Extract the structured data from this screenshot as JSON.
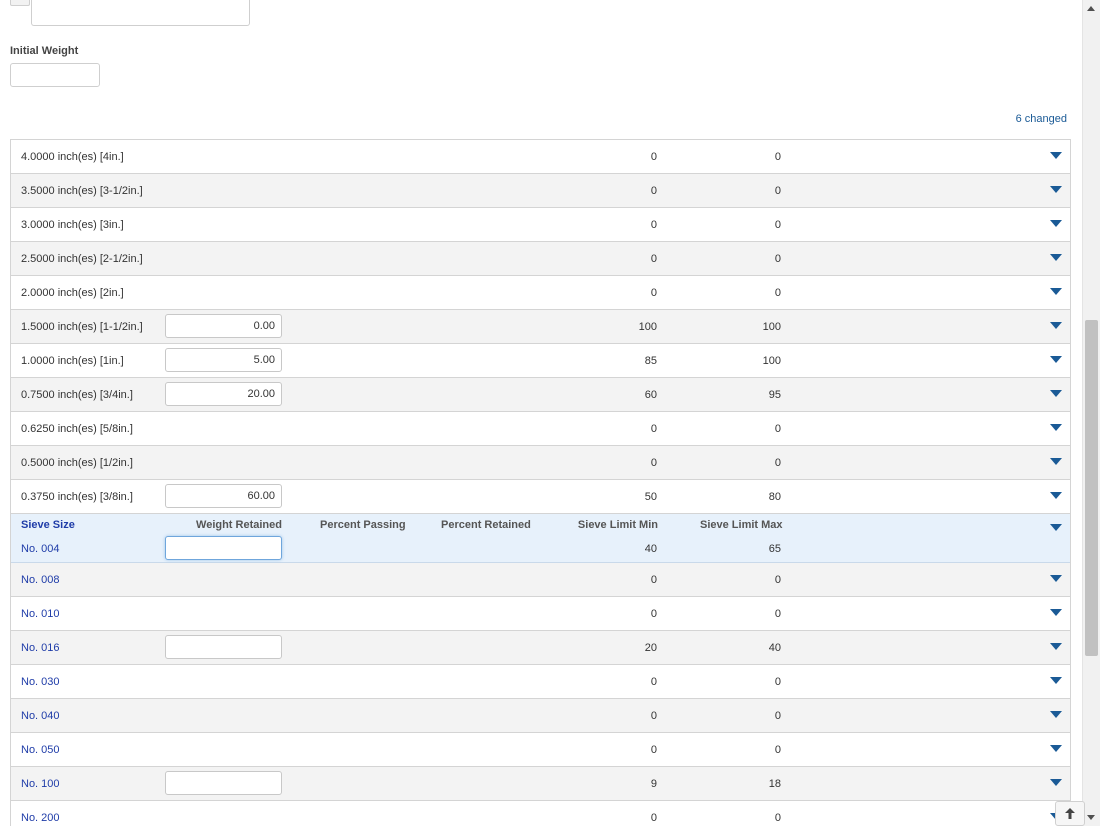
{
  "initial_weight": {
    "label": "Initial Weight",
    "value": ""
  },
  "changed_link": "6 changed",
  "colors": {
    "accent": "#1a5a96",
    "link": "#1f3ca8",
    "header_bg": "#e7f1fb"
  },
  "top_rows": [
    {
      "size": "4.0000 inch(es) [4in.]",
      "min": "0",
      "max": "0"
    },
    {
      "size": "3.5000 inch(es) [3-1/2in.]",
      "min": "0",
      "max": "0"
    },
    {
      "size": "3.0000 inch(es) [3in.]",
      "min": "0",
      "max": "0"
    },
    {
      "size": "2.5000 inch(es) [2-1/2in.]",
      "min": "0",
      "max": "0"
    },
    {
      "size": "2.0000 inch(es) [2in.]",
      "min": "0",
      "max": "0"
    },
    {
      "size": "1.5000 inch(es) [1-1/2in.]",
      "weight": "0.00",
      "min": "100",
      "max": "100"
    },
    {
      "size": "1.0000 inch(es) [1in.]",
      "weight": "5.00",
      "min": "85",
      "max": "100"
    },
    {
      "size": "0.7500 inch(es) [3/4in.]",
      "weight": "20.00",
      "min": "60",
      "max": "95"
    },
    {
      "size": "0.6250 inch(es) [5/8in.]",
      "min": "0",
      "max": "0"
    },
    {
      "size": "0.5000 inch(es) [1/2in.]",
      "min": "0",
      "max": "0"
    },
    {
      "size": "0.3750 inch(es) [3/8in.]",
      "weight": "60.00",
      "min": "50",
      "max": "80"
    }
  ],
  "header": {
    "sieve_size": "Sieve Size",
    "weight_retained": "Weight Retained",
    "percent_passing": "Percent Passing",
    "percent_retained": "Percent Retained",
    "sieve_limit_min": "Sieve Limit Min",
    "sieve_limit_max": "Sieve Limit Max",
    "current": {
      "size": "No. 004",
      "weight": "",
      "min": "40",
      "max": "65"
    }
  },
  "bottom_rows": [
    {
      "size": "No. 008",
      "min": "0",
      "max": "0"
    },
    {
      "size": "No. 010",
      "min": "0",
      "max": "0"
    },
    {
      "size": "No. 016",
      "weight": "",
      "min": "20",
      "max": "40"
    },
    {
      "size": "No. 030",
      "min": "0",
      "max": "0"
    },
    {
      "size": "No. 040",
      "min": "0",
      "max": "0"
    },
    {
      "size": "No. 050",
      "min": "0",
      "max": "0"
    },
    {
      "size": "No. 100",
      "weight": "",
      "min": "9",
      "max": "18"
    },
    {
      "size": "No. 200",
      "min": "0",
      "max": "0"
    }
  ]
}
